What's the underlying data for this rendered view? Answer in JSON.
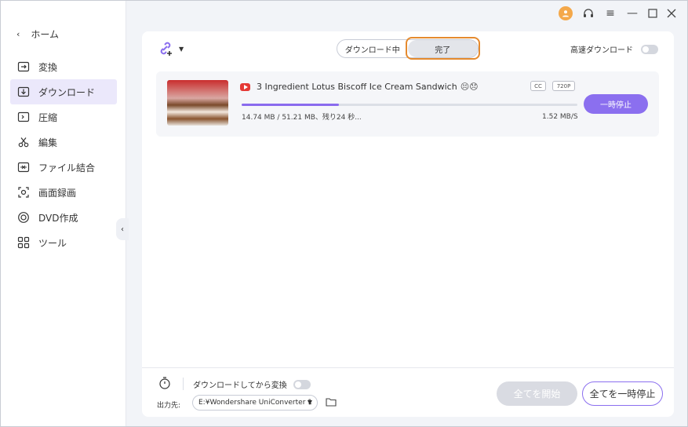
{
  "sidebar": {
    "home_label": "ホーム",
    "items": [
      {
        "label": "変換",
        "icon": "convert-icon"
      },
      {
        "label": "ダウンロード",
        "icon": "download-icon",
        "active": true
      },
      {
        "label": "圧縮",
        "icon": "compress-icon"
      },
      {
        "label": "編集",
        "icon": "scissors-icon"
      },
      {
        "label": "ファイル結合",
        "icon": "merge-icon"
      },
      {
        "label": "画面録画",
        "icon": "screen-record-icon"
      },
      {
        "label": "DVD作成",
        "icon": "dvd-icon"
      },
      {
        "label": "ツール",
        "icon": "toolbox-icon"
      }
    ]
  },
  "header": {
    "tabs": [
      {
        "label": "ダウンロード中"
      },
      {
        "label": "完了",
        "active": true
      }
    ],
    "turbo_label": "高速ダウンロード",
    "turbo_on": false
  },
  "download": {
    "title": "3 Ingredient Lotus Biscoff Ice Cream Sandwich",
    "title_extra": "😣😞",
    "badges": [
      "CC",
      "720P"
    ],
    "progress": 0.29,
    "status": "14.74 MB / 51.21 MB、残り24 秒...",
    "speed": "1.52 MB/S",
    "pause_label": "一時停止"
  },
  "footer": {
    "convert_after_label": "ダウンロードしてから変換",
    "convert_after_on": false,
    "output_label": "出力先:",
    "output_path": "E:¥Wondershare UniConverter 1",
    "start_all_label": "全てを開始",
    "pause_all_label": "全てを一時停止"
  },
  "colors": {
    "accent": "#8b6fef",
    "highlight": "#e58a2e",
    "youtube": "#e53935"
  }
}
